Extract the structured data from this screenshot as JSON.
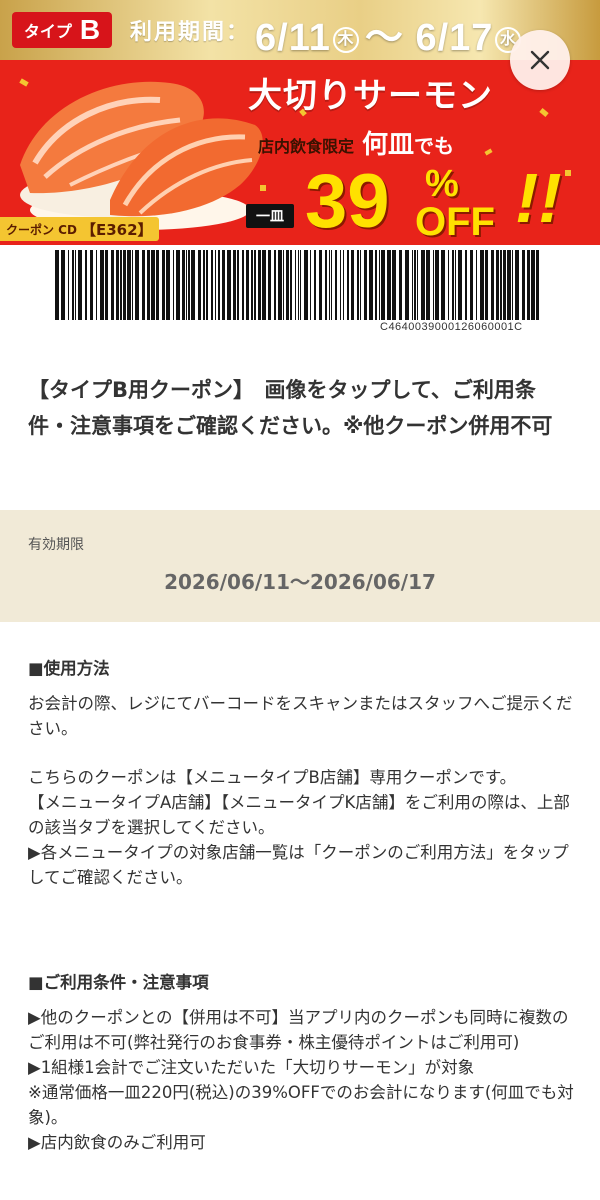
{
  "banner": {
    "type_label": "タイプ",
    "type_letter": "B",
    "period_label": "利用期間：",
    "start_date": "6/11",
    "start_dow": "木",
    "separator": "～",
    "end_date": "6/17",
    "end_dow": "水",
    "headline": "大切りサーモン",
    "in_store_only": "店内飲食限定",
    "any_plates": "何皿",
    "any_plates_suffix": "でも",
    "one_plate": "一皿",
    "discount_number": "39",
    "discount_percent": "%",
    "discount_off": "OFF",
    "exclaim": "!!",
    "coupon_cd_label": "クーポン CD",
    "coupon_cd": "【E362】",
    "colors": {
      "red": "#e8231a",
      "yellow": "#ffe100",
      "gold": "#c9a24a"
    }
  },
  "close_button": {
    "icon": "close-icon"
  },
  "barcode": {
    "number": "C4640039000126060001C"
  },
  "description": "【タイプB用クーポン】　画像をタップして、ご利用条件・注意事項をご確認ください。※他クーポン併用不可",
  "validity": {
    "label": "有効期限",
    "value": "2026/06/11～2026/06/17"
  },
  "usage": {
    "heading": "■使用方法",
    "p1": "お会計の際、レジにてバーコードをスキャンまたはスタッフへご提示ください。",
    "p2": "こちらのクーポンは【メニュータイプB店舗】専用クーポンです。",
    "p3": "【メニュータイプA店舗】【メニュータイプK店舗】をご利用の際は、上部の該当タブを選択してください。",
    "p4": "▶各メニュータイプの対象店舗一覧は「クーポンのご利用方法」をタップしてご確認ください。"
  },
  "conditions": {
    "heading": "■ご利用条件・注意事項",
    "c1": "▶他のクーポンとの【併用は不可】当アプリ内のクーポンも同時に複数のご利用は不可(弊社発行のお食事券・株主優待ポイントはご利用可)",
    "c2": "▶1組様1会計でご注文いただいた「大切りサーモン」が対象",
    "c3": "※通常価格一皿220円(税込)の39%OFFでのお会計になります(何皿でも対象)。",
    "c4": "▶店内飲食のみご利用可"
  }
}
